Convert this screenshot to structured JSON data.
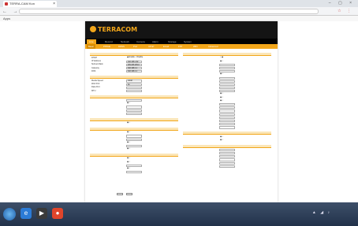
{
  "browser": {
    "tab_title": "TERRA-CAM Kon",
    "tab_close": "×",
    "win_controls": "– ▢ ×",
    "nav_glyphs": "← → ⟳",
    "url": "",
    "bookmarks_label": "Apps",
    "toolbar_glyphs": "☆ ⋮"
  },
  "header": {
    "logo": "TERRACOM",
    "subtitle": "",
    "info_lines": [
      "",
      "",
      ""
    ]
  },
  "topnav": [
    {
      "label": "Live"
    },
    {
      "label": "Record"
    },
    {
      "label": "Network"
    },
    {
      "label": "Camera"
    },
    {
      "label": "Alarm"
    },
    {
      "label": "Storage"
    },
    {
      "label": "System"
    }
  ],
  "subnav": [
    {
      "label": "Basic"
    },
    {
      "label": "PPPoE"
    },
    {
      "label": "DDNS"
    },
    {
      "label": "Port"
    },
    {
      "label": "UPnP"
    },
    {
      "label": "Email"
    },
    {
      "label": "FTP"
    },
    {
      "label": "WiFi"
    },
    {
      "label": "Advanced"
    }
  ],
  "left": [
    {
      "section": "",
      "rows": [
        {
          "label": "DHCP",
          "value": "◉ Enable  ○ Disable",
          "kind": "radio"
        },
        {
          "label": "IP Address",
          "value": "192.168.1.82",
          "kind": "text"
        },
        {
          "label": "Subnet Mask",
          "value": "255.255.255.0",
          "kind": "text"
        },
        {
          "label": "Gateway",
          "value": "192.168.1.1",
          "kind": "text"
        },
        {
          "label": "DNS",
          "value": "192.168.1.1",
          "kind": "text"
        }
      ]
    },
    {
      "section": "",
      "rows": [
        {
          "label": "Media Speed",
          "value": "100M",
          "kind": "text"
        },
        {
          "label": "Web Port",
          "value": "80",
          "kind": "text"
        },
        {
          "label": "Data Port",
          "value": "",
          "kind": "text"
        },
        {
          "label": "MTU",
          "value": "",
          "kind": "text"
        }
      ]
    },
    {
      "section": "",
      "rows": [
        {
          "label": "",
          "value": "",
          "kind": "text"
        },
        {
          "label": "",
          "value": "◉  ○",
          "kind": "radio"
        },
        {
          "label": "",
          "value": "",
          "kind": "text"
        },
        {
          "label": "",
          "value": "",
          "kind": "text"
        },
        {
          "label": "",
          "value": "",
          "kind": "text"
        }
      ]
    },
    {
      "section": "",
      "rows": [
        {
          "label": "",
          "value": "◉  ○",
          "kind": "radio"
        }
      ]
    },
    {
      "section": "",
      "rows": [
        {
          "label": "",
          "value": "◉  ○",
          "kind": "radio"
        },
        {
          "label": "",
          "value": "",
          "kind": "text"
        },
        {
          "label": "",
          "value": "",
          "kind": "text"
        },
        {
          "label": "",
          "value": "◉  ○",
          "kind": "radio"
        },
        {
          "label": "",
          "value": "",
          "kind": "text"
        },
        {
          "label": "",
          "value": "◉  ○",
          "kind": "radio"
        }
      ]
    },
    {
      "section": "",
      "rows": [
        {
          "label": "",
          "value": "◉  ○",
          "kind": "radio"
        },
        {
          "label": "",
          "value": "◉  ○",
          "kind": "radio"
        },
        {
          "label": "",
          "value": "",
          "kind": "text"
        },
        {
          "label": "",
          "value": "◉  ○",
          "kind": "radio"
        },
        {
          "label": "",
          "value": "",
          "kind": "text"
        }
      ]
    }
  ],
  "right": [
    {
      "section": "",
      "rows": [
        {
          "label": "",
          "value": "○  ◉",
          "kind": "radio"
        },
        {
          "label": "",
          "value": "◉  ○",
          "kind": "radio"
        },
        {
          "label": "",
          "value": "",
          "kind": "text"
        },
        {
          "label": "",
          "value": "",
          "kind": "text"
        },
        {
          "label": "",
          "value": "",
          "kind": "text"
        },
        {
          "label": "",
          "value": "◉  ○",
          "kind": "radio"
        },
        {
          "label": "",
          "value": "",
          "kind": "text"
        },
        {
          "label": "",
          "value": "",
          "kind": "text"
        },
        {
          "label": "",
          "value": "",
          "kind": "text"
        },
        {
          "label": "",
          "value": "",
          "kind": "text"
        },
        {
          "label": "",
          "value": "",
          "kind": "text"
        },
        {
          "label": "",
          "value": "◉  ○",
          "kind": "radio"
        },
        {
          "label": "",
          "value": "◉  ○",
          "kind": "radio"
        },
        {
          "label": "",
          "value": "◉  ○",
          "kind": "radio"
        },
        {
          "label": "",
          "value": "",
          "kind": "text"
        },
        {
          "label": "",
          "value": "",
          "kind": "text"
        },
        {
          "label": "",
          "value": "",
          "kind": "text"
        },
        {
          "label": "",
          "value": "",
          "kind": "text"
        },
        {
          "label": "",
          "value": "",
          "kind": "text"
        },
        {
          "label": "",
          "value": "",
          "kind": "text"
        },
        {
          "label": "",
          "value": "",
          "kind": "text"
        },
        {
          "label": "",
          "value": "",
          "kind": "text"
        }
      ]
    },
    {
      "section": "",
      "rows": [
        {
          "label": "",
          "value": "◉  ○",
          "kind": "radio"
        },
        {
          "label": "",
          "value": "◉  ○",
          "kind": "radio"
        }
      ]
    },
    {
      "section": "",
      "rows": [
        {
          "label": "",
          "value": "",
          "kind": "text"
        },
        {
          "label": "",
          "value": "",
          "kind": "text"
        },
        {
          "label": "",
          "value": "",
          "kind": "text"
        },
        {
          "label": "",
          "value": "",
          "kind": "text"
        },
        {
          "label": "",
          "value": "",
          "kind": "text"
        },
        {
          "label": "",
          "value": "",
          "kind": "text"
        }
      ]
    }
  ],
  "buttons": {
    "save": "",
    "refresh": ""
  },
  "taskbar": {
    "icons": [
      "e",
      "▶",
      "●"
    ],
    "icon_colors": [
      "#2b7bd6",
      "#3a3a3a",
      "#e0452b"
    ],
    "tray_icons": "▲ ◢ ♪",
    "time": "",
    "date": ""
  }
}
